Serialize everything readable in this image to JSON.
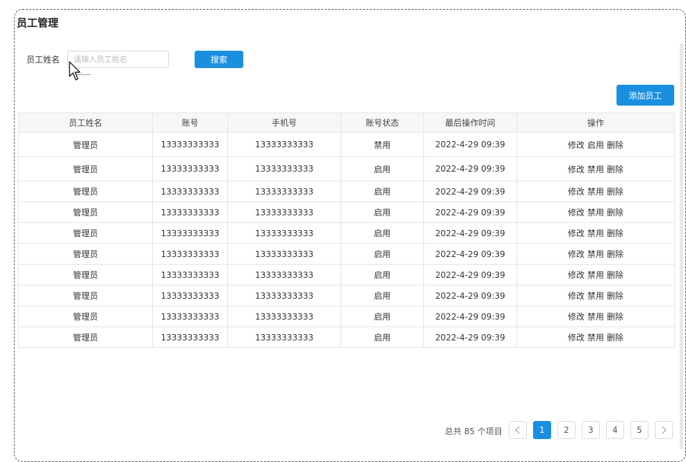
{
  "page": {
    "title": "员工管理"
  },
  "search": {
    "label": "员工姓名",
    "placeholder": "请输入员工姓名",
    "value": "",
    "button_label": "搜索"
  },
  "toolbar": {
    "add_label": "添加员工"
  },
  "table": {
    "headers": [
      "员工姓名",
      "账号",
      "手机号",
      "账号状态",
      "最后操作时间",
      "操作"
    ],
    "rows": [
      {
        "name": "管理员",
        "account": "13333333333",
        "phone": "13333333333",
        "status": "禁用",
        "time": "2022-4-29 09:39",
        "actions": [
          "修改",
          "启用",
          "删除"
        ]
      },
      {
        "name": "管理员",
        "account": "13333333333",
        "phone": "13333333333",
        "status": "启用",
        "time": "2022-4-29 09:39",
        "actions": [
          "修改",
          "禁用",
          "删除"
        ]
      },
      {
        "name": "管理员",
        "account": "13333333333",
        "phone": "13333333333",
        "status": "启用",
        "time": "2022-4-29 09:39",
        "actions": [
          "修改",
          "禁用",
          "删除"
        ]
      },
      {
        "name": "管理员",
        "account": "13333333333",
        "phone": "13333333333",
        "status": "启用",
        "time": "2022-4-29 09:39",
        "actions": [
          "修改",
          "禁用",
          "删除"
        ]
      },
      {
        "name": "管理员",
        "account": "13333333333",
        "phone": "13333333333",
        "status": "启用",
        "time": "2022-4-29 09:39",
        "actions": [
          "修改",
          "禁用",
          "删除"
        ]
      },
      {
        "name": "管理员",
        "account": "13333333333",
        "phone": "13333333333",
        "status": "启用",
        "time": "2022-4-29 09:39",
        "actions": [
          "修改",
          "禁用",
          "删除"
        ]
      },
      {
        "name": "管理员",
        "account": "13333333333",
        "phone": "13333333333",
        "status": "启用",
        "time": "2022-4-29 09:39",
        "actions": [
          "修改",
          "禁用",
          "删除"
        ]
      },
      {
        "name": "管理员",
        "account": "13333333333",
        "phone": "13333333333",
        "status": "启用",
        "time": "2022-4-29 09:39",
        "actions": [
          "修改",
          "禁用",
          "删除"
        ]
      },
      {
        "name": "管理员",
        "account": "13333333333",
        "phone": "13333333333",
        "status": "启用",
        "time": "2022-4-29 09:39",
        "actions": [
          "修改",
          "禁用",
          "删除"
        ]
      },
      {
        "name": "管理员",
        "account": "13333333333",
        "phone": "13333333333",
        "status": "启用",
        "time": "2022-4-29 09:39",
        "actions": [
          "修改",
          "禁用",
          "删除"
        ]
      }
    ]
  },
  "pagination": {
    "total_text": "总共 85 个项目",
    "pages": [
      "1",
      "2",
      "3",
      "4",
      "5"
    ],
    "current": "1",
    "prev_icon": "chevron-left-icon",
    "next_icon": "chevron-right-icon"
  },
  "colors": {
    "primary": "#1a8fe0",
    "header_bg": "#f6f7f9",
    "border": "#e4e4e4"
  }
}
